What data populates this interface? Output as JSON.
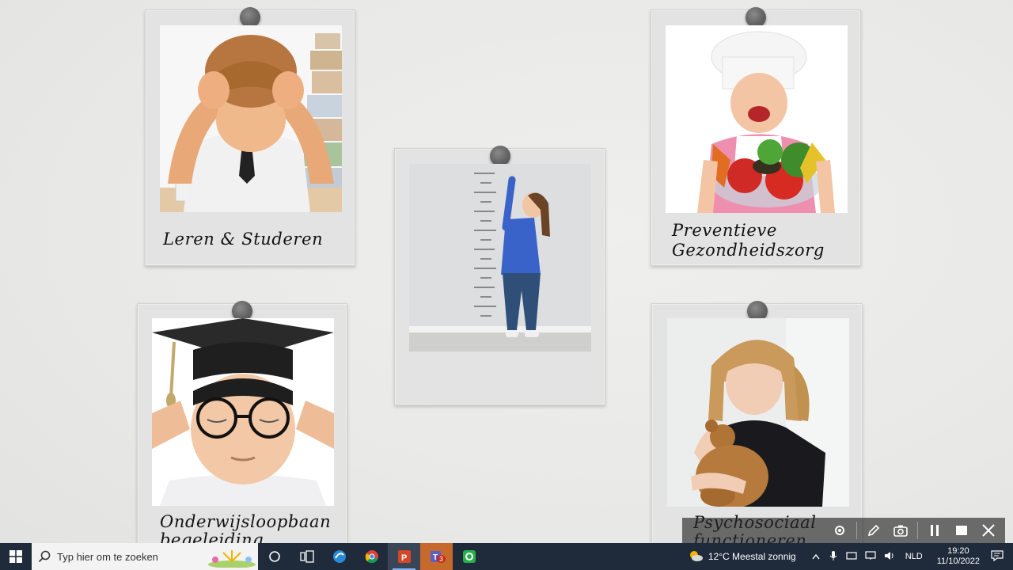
{
  "cards": {
    "c1": {
      "caption": "Leren & Studeren"
    },
    "c2": {
      "caption": ""
    },
    "c3": {
      "caption_line1": "Preventieve",
      "caption_line2": "Gezondheidszorg"
    },
    "c4": {
      "caption_line1": "Onderwijsloopbaan",
      "caption_line2": "begeleiding"
    },
    "c5": {
      "caption_line1": "Psychosociaal",
      "caption_line2": "functioneren"
    }
  },
  "taskbar": {
    "search_placeholder": "Typ hier om te zoeken",
    "weather": "12°C  Meestal zonnig",
    "language": "NLD",
    "time": "19:20",
    "date": "11/10/2022",
    "teams_badge": "3"
  },
  "colors": {
    "taskbar": "#1f2a3a",
    "card": "#e3e3e3",
    "pin": "#626262"
  }
}
